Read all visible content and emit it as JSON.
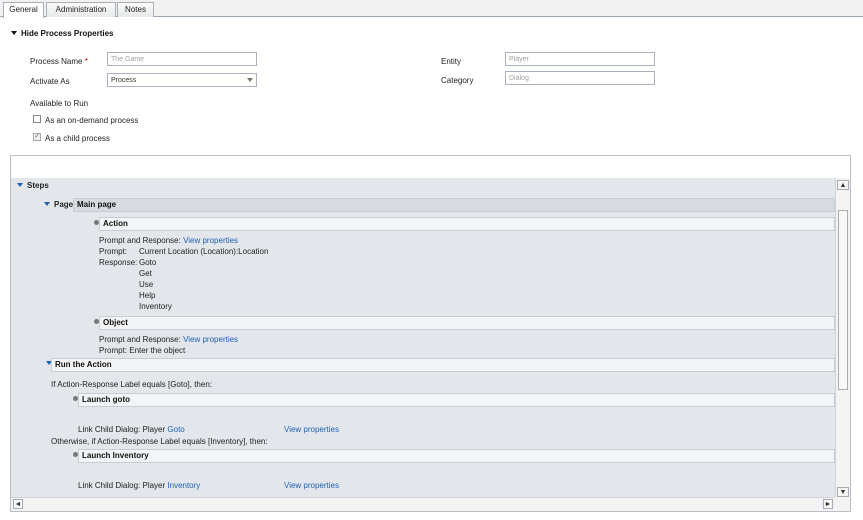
{
  "tabs": [
    "General",
    "Administration",
    "Notes"
  ],
  "properties": {
    "toggle_label": "Hide Process Properties",
    "process_name_label": "Process Name",
    "process_name_required": "*",
    "process_name_value": "The Game",
    "activate_as_label": "Activate As",
    "activate_as_value": "Process",
    "entity_label": "Entity",
    "entity_value": "Player",
    "category_label": "Category",
    "category_value": "Dialog",
    "available_to_run_label": "Available to Run",
    "on_demand_label": "As an on-demand process",
    "on_demand_checked": false,
    "child_process_label": "As a child process",
    "child_process_checked": true
  },
  "steps": {
    "header": "Steps",
    "page_label": "Page:",
    "page_name": "Main page",
    "action_step": {
      "title": "Action",
      "pr_label": "Prompt and Response:",
      "view_link": "View properties",
      "prompt_label": "Prompt:",
      "prompt_value": "Current Location (Location):Location",
      "response_label": "Response:",
      "responses": [
        "Goto",
        "Get",
        "Use",
        "Help",
        "Inventory"
      ]
    },
    "object_step": {
      "title": "Object",
      "pr_label": "Prompt and Response:",
      "view_link": "View properties",
      "prompt_text": "Prompt:  Enter the object"
    },
    "run_action": {
      "title": "Run the Action",
      "condition1": "If Action-Response Label equals [Goto], then:",
      "launch1_title": "Launch goto",
      "launch1_text": "Link Child Dialog:  Player",
      "launch1_link": "Goto",
      "launch1_view": "View properties",
      "condition2": "Otherwise, if Action-Response Label equals [Inventory], then:",
      "launch2_title": "Launch Inventory",
      "launch2_text": "Link Child Dialog:  Player",
      "launch2_link": "Inventory",
      "launch2_view": "View properties"
    }
  },
  "icons": {
    "scroll_up": "▲",
    "scroll_down": "▼",
    "scroll_left": "◄",
    "scroll_right": "►"
  }
}
